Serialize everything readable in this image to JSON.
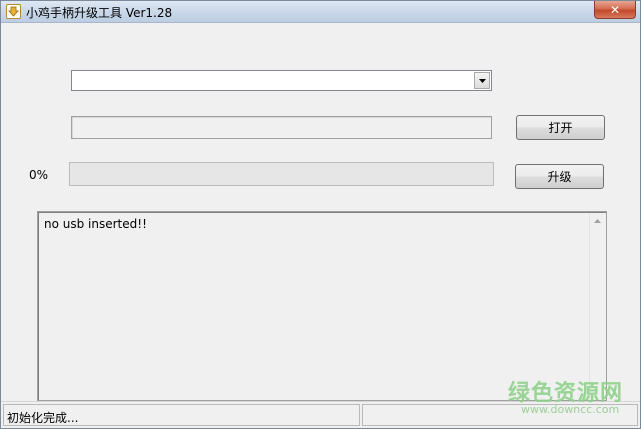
{
  "window": {
    "title": "小鸡手柄升级工具 Ver1.28",
    "icon": "app-download-icon",
    "close_glyph": "✕"
  },
  "device_select": {
    "selected": ""
  },
  "file_path": {
    "value": ""
  },
  "buttons": {
    "open_label": "打开",
    "upgrade_label": "升级"
  },
  "progress": {
    "label": "0%",
    "value": 0
  },
  "log": {
    "text": "no usb inserted!!"
  },
  "status_bar": {
    "message": "初始化完成...",
    "secondary": ""
  },
  "watermark": {
    "brand": "绿色资源网",
    "url": "www.downcc.com"
  },
  "colors": {
    "watermark_green": "#8fd18a",
    "close_red": "#c3472b"
  }
}
